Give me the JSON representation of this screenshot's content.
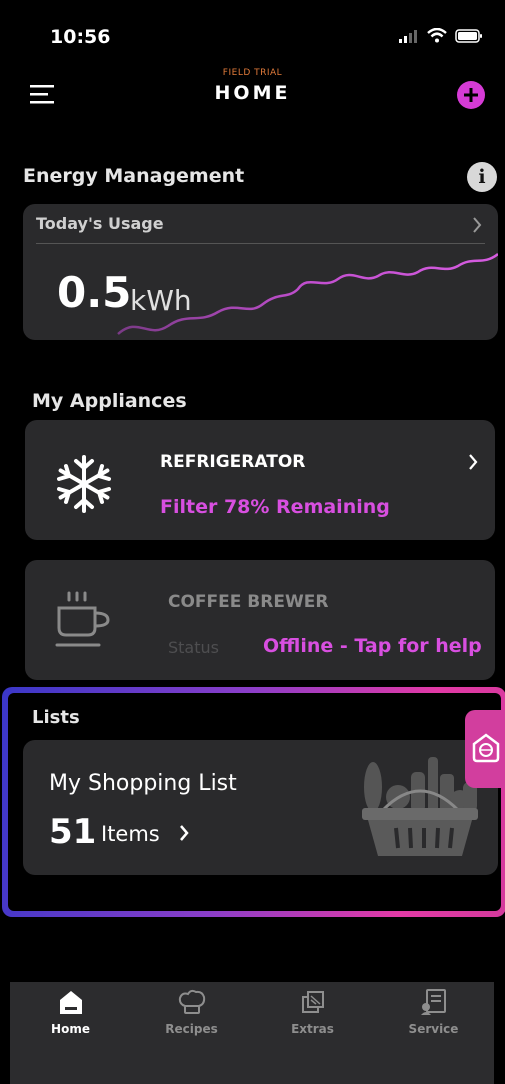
{
  "status_bar": {
    "time": "10:56"
  },
  "header": {
    "trial_label": "FIELD TRIAL",
    "title": "HOME"
  },
  "energy": {
    "section_title": "Energy Management",
    "usage_label": "Today's Usage",
    "usage_value": "0.5",
    "usage_unit": "kWh"
  },
  "appliances": {
    "section_title": "My Appliances",
    "items": [
      {
        "name": "REFRIGERATOR",
        "status": "Filter 78% Remaining",
        "icon": "snowflake-icon"
      },
      {
        "name": "COFFEE BREWER",
        "status_label": "Status",
        "status": "Offline - Tap for help",
        "icon": "coffee-cup-icon"
      }
    ]
  },
  "lists": {
    "section_title": "Lists",
    "shopping_title": "My Shopping List",
    "item_count": "51",
    "items_label": "Items"
  },
  "nav": {
    "items": [
      {
        "label": "Home",
        "icon": "home-icon"
      },
      {
        "label": "Recipes",
        "icon": "chef-hat-icon"
      },
      {
        "label": "Extras",
        "icon": "extras-icon"
      },
      {
        "label": "Service",
        "icon": "service-icon"
      }
    ]
  },
  "colors": {
    "accent": "#d63bd6",
    "card": "#2a2a2c",
    "status_text": "#d84fe0"
  }
}
